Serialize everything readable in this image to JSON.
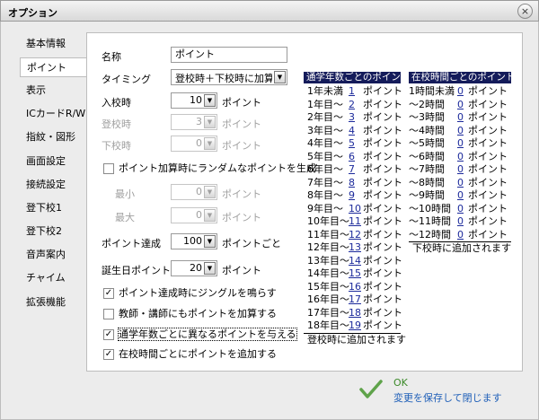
{
  "window": {
    "title": "オプション",
    "close_glyph": "×"
  },
  "sidebar": {
    "items": [
      {
        "label": "基本情報"
      },
      {
        "label": "ポイント"
      },
      {
        "label": "表示"
      },
      {
        "label": "ICカードR/W"
      },
      {
        "label": "指紋・図形"
      },
      {
        "label": "画面設定"
      },
      {
        "label": "接続設定"
      },
      {
        "label": "登下校1"
      },
      {
        "label": "登下校2"
      },
      {
        "label": "音声案内"
      },
      {
        "label": "チャイム"
      },
      {
        "label": "拡張機能"
      }
    ],
    "active_index": 1
  },
  "form": {
    "name_label": "名称",
    "name_value": "ポイント",
    "timing_label": "タイミング",
    "timing_value": "登校時＋下校時に加算",
    "enter_label": "入校時",
    "enter_value": "10",
    "enter_unit": "ポイント",
    "arrive_label": "登校時",
    "arrive_value": "3",
    "arrive_unit": "ポイント",
    "leave_label": "下校時",
    "leave_value": "0",
    "leave_unit": "ポイント",
    "random_check": "ポイント加算時にランダムなポイントを生成",
    "min_label": "最小",
    "min_value": "0",
    "min_unit": "ポイント",
    "max_label": "最大",
    "max_value": "0",
    "max_unit": "ポイント",
    "achieve_label": "ポイント達成",
    "achieve_value": "100",
    "achieve_unit": "ポイントごと",
    "birthday_label": "誕生日ポイント",
    "birthday_value": "20",
    "birthday_unit": "ポイント",
    "check_jingle": "ポイント達成時にジングルを鳴らす",
    "check_teacher": "教師・講師にもポイントを加算する",
    "check_years": "通学年数ごとに異なるポイントを与える",
    "check_hours": "在校時間ごとにポイントを追加する",
    "checked_mark": "✓",
    "arrow": "▼"
  },
  "years_table": {
    "header": "通学年数ごとのポイント",
    "rows": [
      {
        "label": "1年未満",
        "value": "1",
        "unit": "ポイント"
      },
      {
        "label": "1年目～",
        "value": "2",
        "unit": "ポイント"
      },
      {
        "label": "2年目～",
        "value": "3",
        "unit": "ポイント"
      },
      {
        "label": "3年目～",
        "value": "4",
        "unit": "ポイント"
      },
      {
        "label": "4年目～",
        "value": "5",
        "unit": "ポイント"
      },
      {
        "label": "5年目～",
        "value": "6",
        "unit": "ポイント"
      },
      {
        "label": "6年目～",
        "value": "7",
        "unit": "ポイント"
      },
      {
        "label": "7年目～",
        "value": "8",
        "unit": "ポイント"
      },
      {
        "label": "8年目～",
        "value": "9",
        "unit": "ポイント"
      },
      {
        "label": "9年目～",
        "value": "10",
        "unit": "ポイント"
      },
      {
        "label": "10年目～",
        "value": "11",
        "unit": "ポイント"
      },
      {
        "label": "11年目～",
        "value": "12",
        "unit": "ポイント"
      },
      {
        "label": "12年目～",
        "value": "13",
        "unit": "ポイント"
      },
      {
        "label": "13年目～",
        "value": "14",
        "unit": "ポイント"
      },
      {
        "label": "14年目～",
        "value": "15",
        "unit": "ポイント"
      },
      {
        "label": "15年目～",
        "value": "16",
        "unit": "ポイント"
      },
      {
        "label": "16年目～",
        "value": "17",
        "unit": "ポイント"
      },
      {
        "label": "17年目～",
        "value": "18",
        "unit": "ポイント"
      },
      {
        "label": "18年目～",
        "value": "19",
        "unit": "ポイント"
      }
    ],
    "footer": "登校時に追加されます"
  },
  "hours_table": {
    "header": "在校時間ごとのポイント",
    "rows": [
      {
        "label": "1時間未満",
        "value": "0",
        "unit": "ポイント"
      },
      {
        "label": "～2時間",
        "value": "0",
        "unit": "ポイント"
      },
      {
        "label": "～3時間",
        "value": "0",
        "unit": "ポイント"
      },
      {
        "label": "～4時間",
        "value": "0",
        "unit": "ポイント"
      },
      {
        "label": "～5時間",
        "value": "0",
        "unit": "ポイント"
      },
      {
        "label": "～6時間",
        "value": "0",
        "unit": "ポイント"
      },
      {
        "label": "～7時間",
        "value": "0",
        "unit": "ポイント"
      },
      {
        "label": "～8時間",
        "value": "0",
        "unit": "ポイント"
      },
      {
        "label": "～9時間",
        "value": "0",
        "unit": "ポイント"
      },
      {
        "label": "～10時間",
        "value": "0",
        "unit": "ポイント"
      },
      {
        "label": "～11時間",
        "value": "0",
        "unit": "ポイント"
      },
      {
        "label": "～12時間",
        "value": "0",
        "unit": "ポイント"
      }
    ],
    "footer": "下校時に追加されます"
  },
  "ok_button": {
    "title": "OK",
    "subtitle": "変更を保存して閉じます"
  },
  "colors": {
    "table_header_bg": "#141b5a",
    "link_blue": "#1c2a9b",
    "ok_green": "#3c8a2a",
    "ok_blue": "#1f5fb8"
  }
}
